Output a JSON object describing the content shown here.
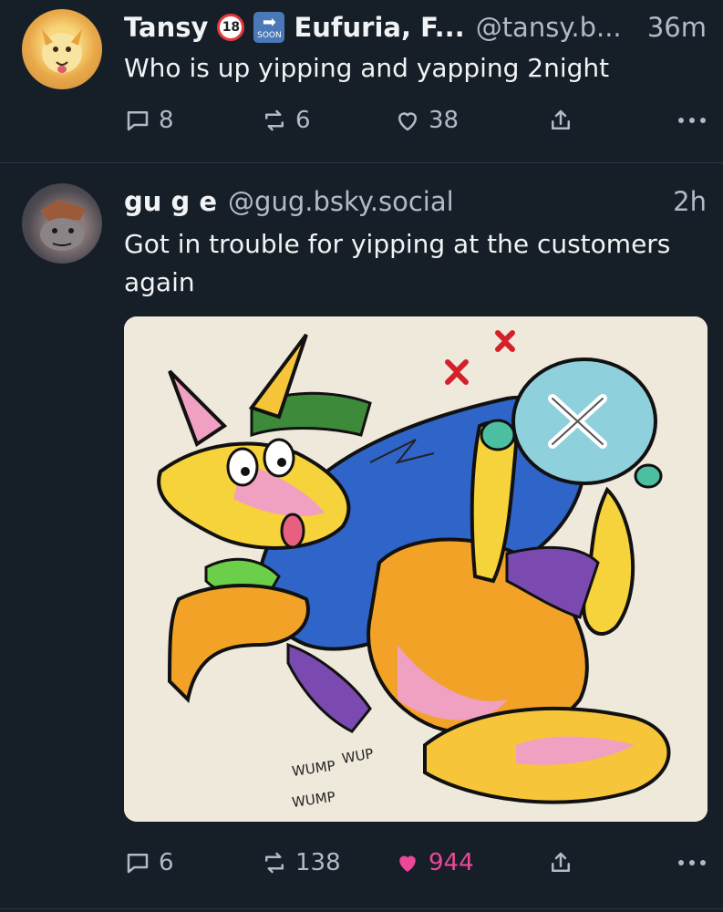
{
  "posts": [
    {
      "author": {
        "name": "Tansy",
        "display_suffix": "Eufuria, F...",
        "handle": "@tansy.b...",
        "time": "36m"
      },
      "badges": [
        {
          "name": "under-18-icon",
          "label": "18"
        },
        {
          "name": "soon-arrow-icon",
          "label": "SOON"
        }
      ],
      "text": "Who is up yipping and yapping 2night",
      "actions": {
        "replies": "8",
        "reposts": "6",
        "likes": "38"
      }
    },
    {
      "author": {
        "name": "gu g e",
        "handle": "@gug.bsky.social",
        "time": "2h"
      },
      "text": "Got in trouble for yipping at the customers again",
      "image_caption_words": [
        "WUMP",
        "WUMP",
        "WUP"
      ],
      "actions": {
        "replies": "6",
        "reposts": "138",
        "likes": "944"
      }
    }
  ],
  "colors": {
    "background": "#161e27",
    "text": "#f1f3f5",
    "muted": "#aebbc9",
    "like": "#ec4899",
    "divider": "#2a3441"
  }
}
